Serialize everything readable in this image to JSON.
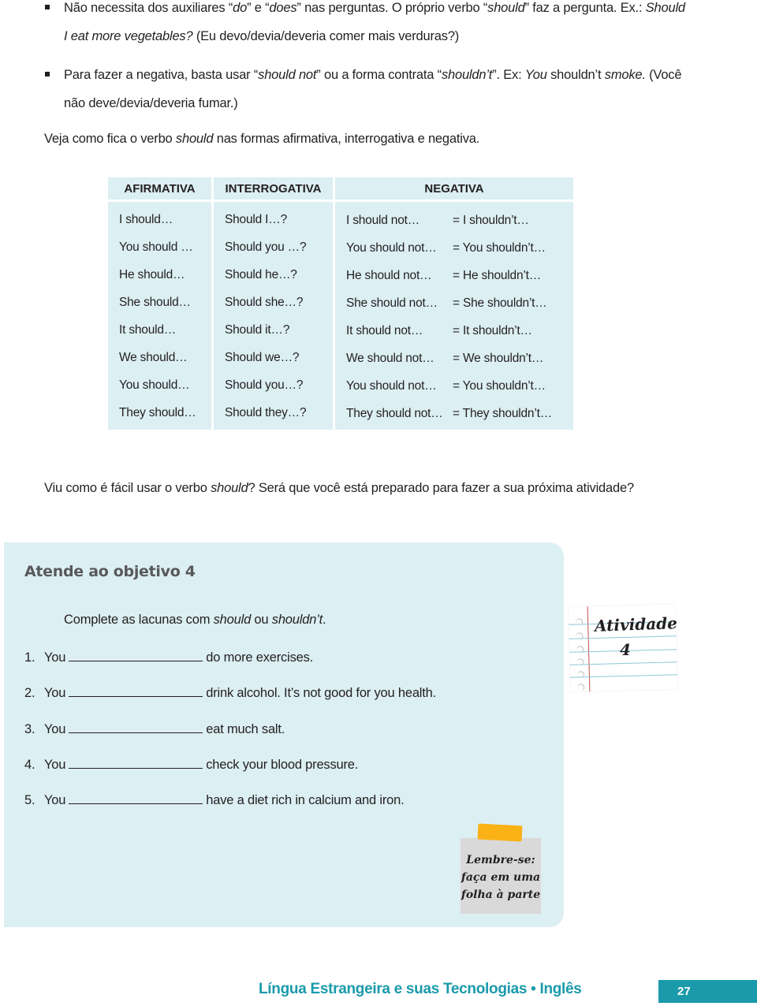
{
  "bullets": [
    {
      "line1": [
        {
          "t": "Não necessita dos auxiliares “",
          "i": false
        },
        {
          "t": "do",
          "i": true
        },
        {
          "t": "” e “",
          "i": false
        },
        {
          "t": "does",
          "i": true
        },
        {
          "t": "” nas perguntas. O próprio verbo “",
          "i": false
        },
        {
          "t": "should",
          "i": true
        },
        {
          "t": "” faz a pergunta. Ex.: ",
          "i": false
        },
        {
          "t": "Should",
          "i": true
        }
      ],
      "line2": [
        {
          "t": "I eat more vegetables?",
          "i": true
        },
        {
          "t": " (Eu devo/devia/deveria comer mais verduras?)",
          "i": false
        }
      ]
    },
    {
      "line1": [
        {
          "t": "Para fazer a negativa, basta usar “",
          "i": false
        },
        {
          "t": "should not",
          "i": true
        },
        {
          "t": "” ou a forma contrata “",
          "i": false
        },
        {
          "t": "shouldn’t",
          "i": true
        },
        {
          "t": "”. Ex: ",
          "i": false
        },
        {
          "t": "You",
          "i": true
        },
        {
          "t": " shouldn’t ",
          "i": false
        },
        {
          "t": "smoke.",
          "i": true
        },
        {
          "t": " (Você",
          "i": false
        }
      ],
      "line2": [
        {
          "t": "não deve/devia/deveria fumar.)",
          "i": false
        }
      ]
    }
  ],
  "intro": [
    {
      "t": "Veja como fica o verbo ",
      "i": false
    },
    {
      "t": "should",
      "i": true
    },
    {
      "t": " nas formas afirmativa, interrogativa e negativa.",
      "i": false
    }
  ],
  "table": {
    "headers": [
      "AFIRMATIVA",
      "INTERROGATIVA",
      "NEGATIVA"
    ],
    "rows": [
      {
        "afirmativa": "I should…",
        "interrogativa": "Should I…?",
        "negativa": "I should not…",
        "contracted": "= I shouldn’t…"
      },
      {
        "afirmativa": "You should …",
        "interrogativa": "Should you …?",
        "negativa": "You should not…",
        "contracted": "= You shouldn’t…"
      },
      {
        "afirmativa": "He should…",
        "interrogativa": "Should he…?",
        "negativa": "He should not…",
        "contracted": "= He shouldn’t…"
      },
      {
        "afirmativa": "She should…",
        "interrogativa": "Should she…?",
        "negativa": "She should not…",
        "contracted": "= She shouldn’t…"
      },
      {
        "afirmativa": "It should…",
        "interrogativa": "Should it…?",
        "negativa": "It should not…",
        "contracted": "= It shouldn’t…"
      },
      {
        "afirmativa": "We should…",
        "interrogativa": "Should we…?",
        "negativa": "We should not…",
        "contracted": "= We shouldn’t…"
      },
      {
        "afirmativa": "You should…",
        "interrogativa": "Should you…?",
        "negativa": "You should not…",
        "contracted": "= You shouldn’t…"
      },
      {
        "afirmativa": "They should…",
        "interrogativa": "Should they…?",
        "negativa": "They should not…",
        "contracted": "= They shouldn’t…"
      }
    ]
  },
  "outro": [
    {
      "t": "Viu como é fácil usar o verbo ",
      "i": false
    },
    {
      "t": "should",
      "i": true
    },
    {
      "t": "? Será que você está preparado para fazer a sua próxima atividade?",
      "i": false
    }
  ],
  "activity": {
    "title": "Atende ao objetivo 4",
    "instruction": [
      {
        "t": "Complete as lacunas com ",
        "i": false
      },
      {
        "t": "should",
        "i": true
      },
      {
        "t": " ou ",
        "i": false
      },
      {
        "t": "shouldn’t",
        "i": true
      },
      {
        "t": ".",
        "i": false
      }
    ],
    "items": [
      {
        "num": "1.",
        "subject": "You",
        "answer": "",
        "rest": "do more exercises."
      },
      {
        "num": "2.",
        "subject": "You",
        "answer": "",
        "rest": "drink alcohol. It’s not good for you health."
      },
      {
        "num": "3.",
        "subject": "You",
        "answer": "",
        "rest": "eat much salt."
      },
      {
        "num": "4.",
        "subject": "You",
        "answer": "",
        "rest": "check your blood pressure."
      },
      {
        "num": "5.",
        "subject": "You",
        "answer": "",
        "rest": "have a diet rich in calcium and iron."
      }
    ],
    "badge": {
      "title": "Atividade",
      "number": "4"
    },
    "reminder": [
      "Lembre-se:",
      "faça em uma",
      "folha à parte"
    ]
  },
  "footer": {
    "text": "Língua Estrangeira e suas Tecnologias • Inglês",
    "page": "27",
    "accent_color": "#1a9aab"
  },
  "colors": {
    "panel": "#dceff3",
    "title_gray": "#58595b",
    "tape": "#fbb215",
    "sticky": "#d9d9d9"
  }
}
